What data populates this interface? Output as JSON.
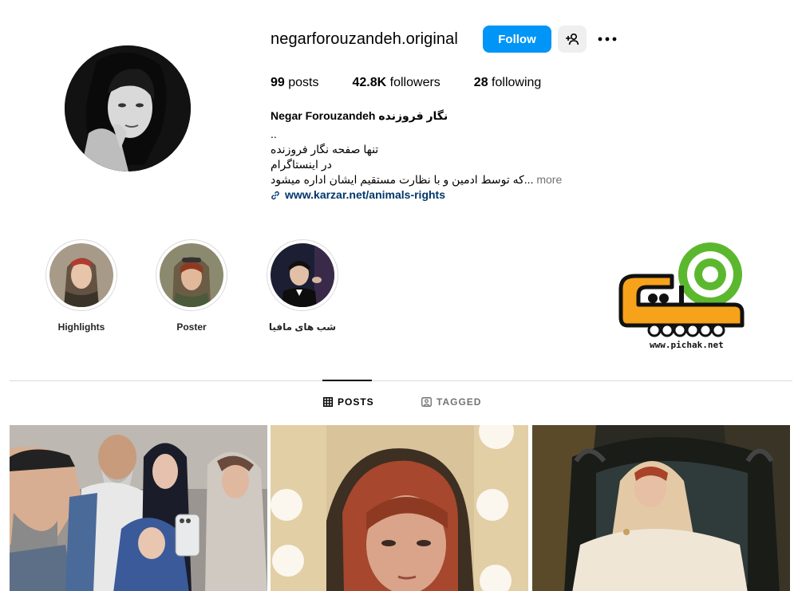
{
  "profile": {
    "username": "negarforouzandeh.original",
    "follow_label": "Follow",
    "stats": {
      "posts_count": "99",
      "posts_label": "posts",
      "followers_count": "42.8K",
      "followers_label": "followers",
      "following_count": "28",
      "following_label": "following"
    },
    "bio": {
      "name": "Negar Forouzandeh نگار فروزنده",
      "line1": "..",
      "line2": "تنها صفحه نگار فروزنده",
      "line3": "در اینستاگرام",
      "line4": "که توسط ادمین و با نظارت مستقیم ایشان اداره میشود...",
      "more_label": "more",
      "link_text": "www.karzar.net/animals-rights"
    }
  },
  "highlights": [
    {
      "label": "Highlights"
    },
    {
      "label": "Poster"
    },
    {
      "label": "شب های مافیا"
    }
  ],
  "watermark": {
    "url_text": "www.pichak.net"
  },
  "tabs": {
    "posts_label": "POSTS",
    "tagged_label": "TAGGED"
  },
  "colors": {
    "accent": "#0095f6",
    "link": "#00376b",
    "muted": "#737373",
    "border": "#dbdbdb"
  },
  "icons": [
    "person-add-icon",
    "more-dots-icon",
    "link-icon",
    "grid-icon",
    "tagged-icon"
  ]
}
